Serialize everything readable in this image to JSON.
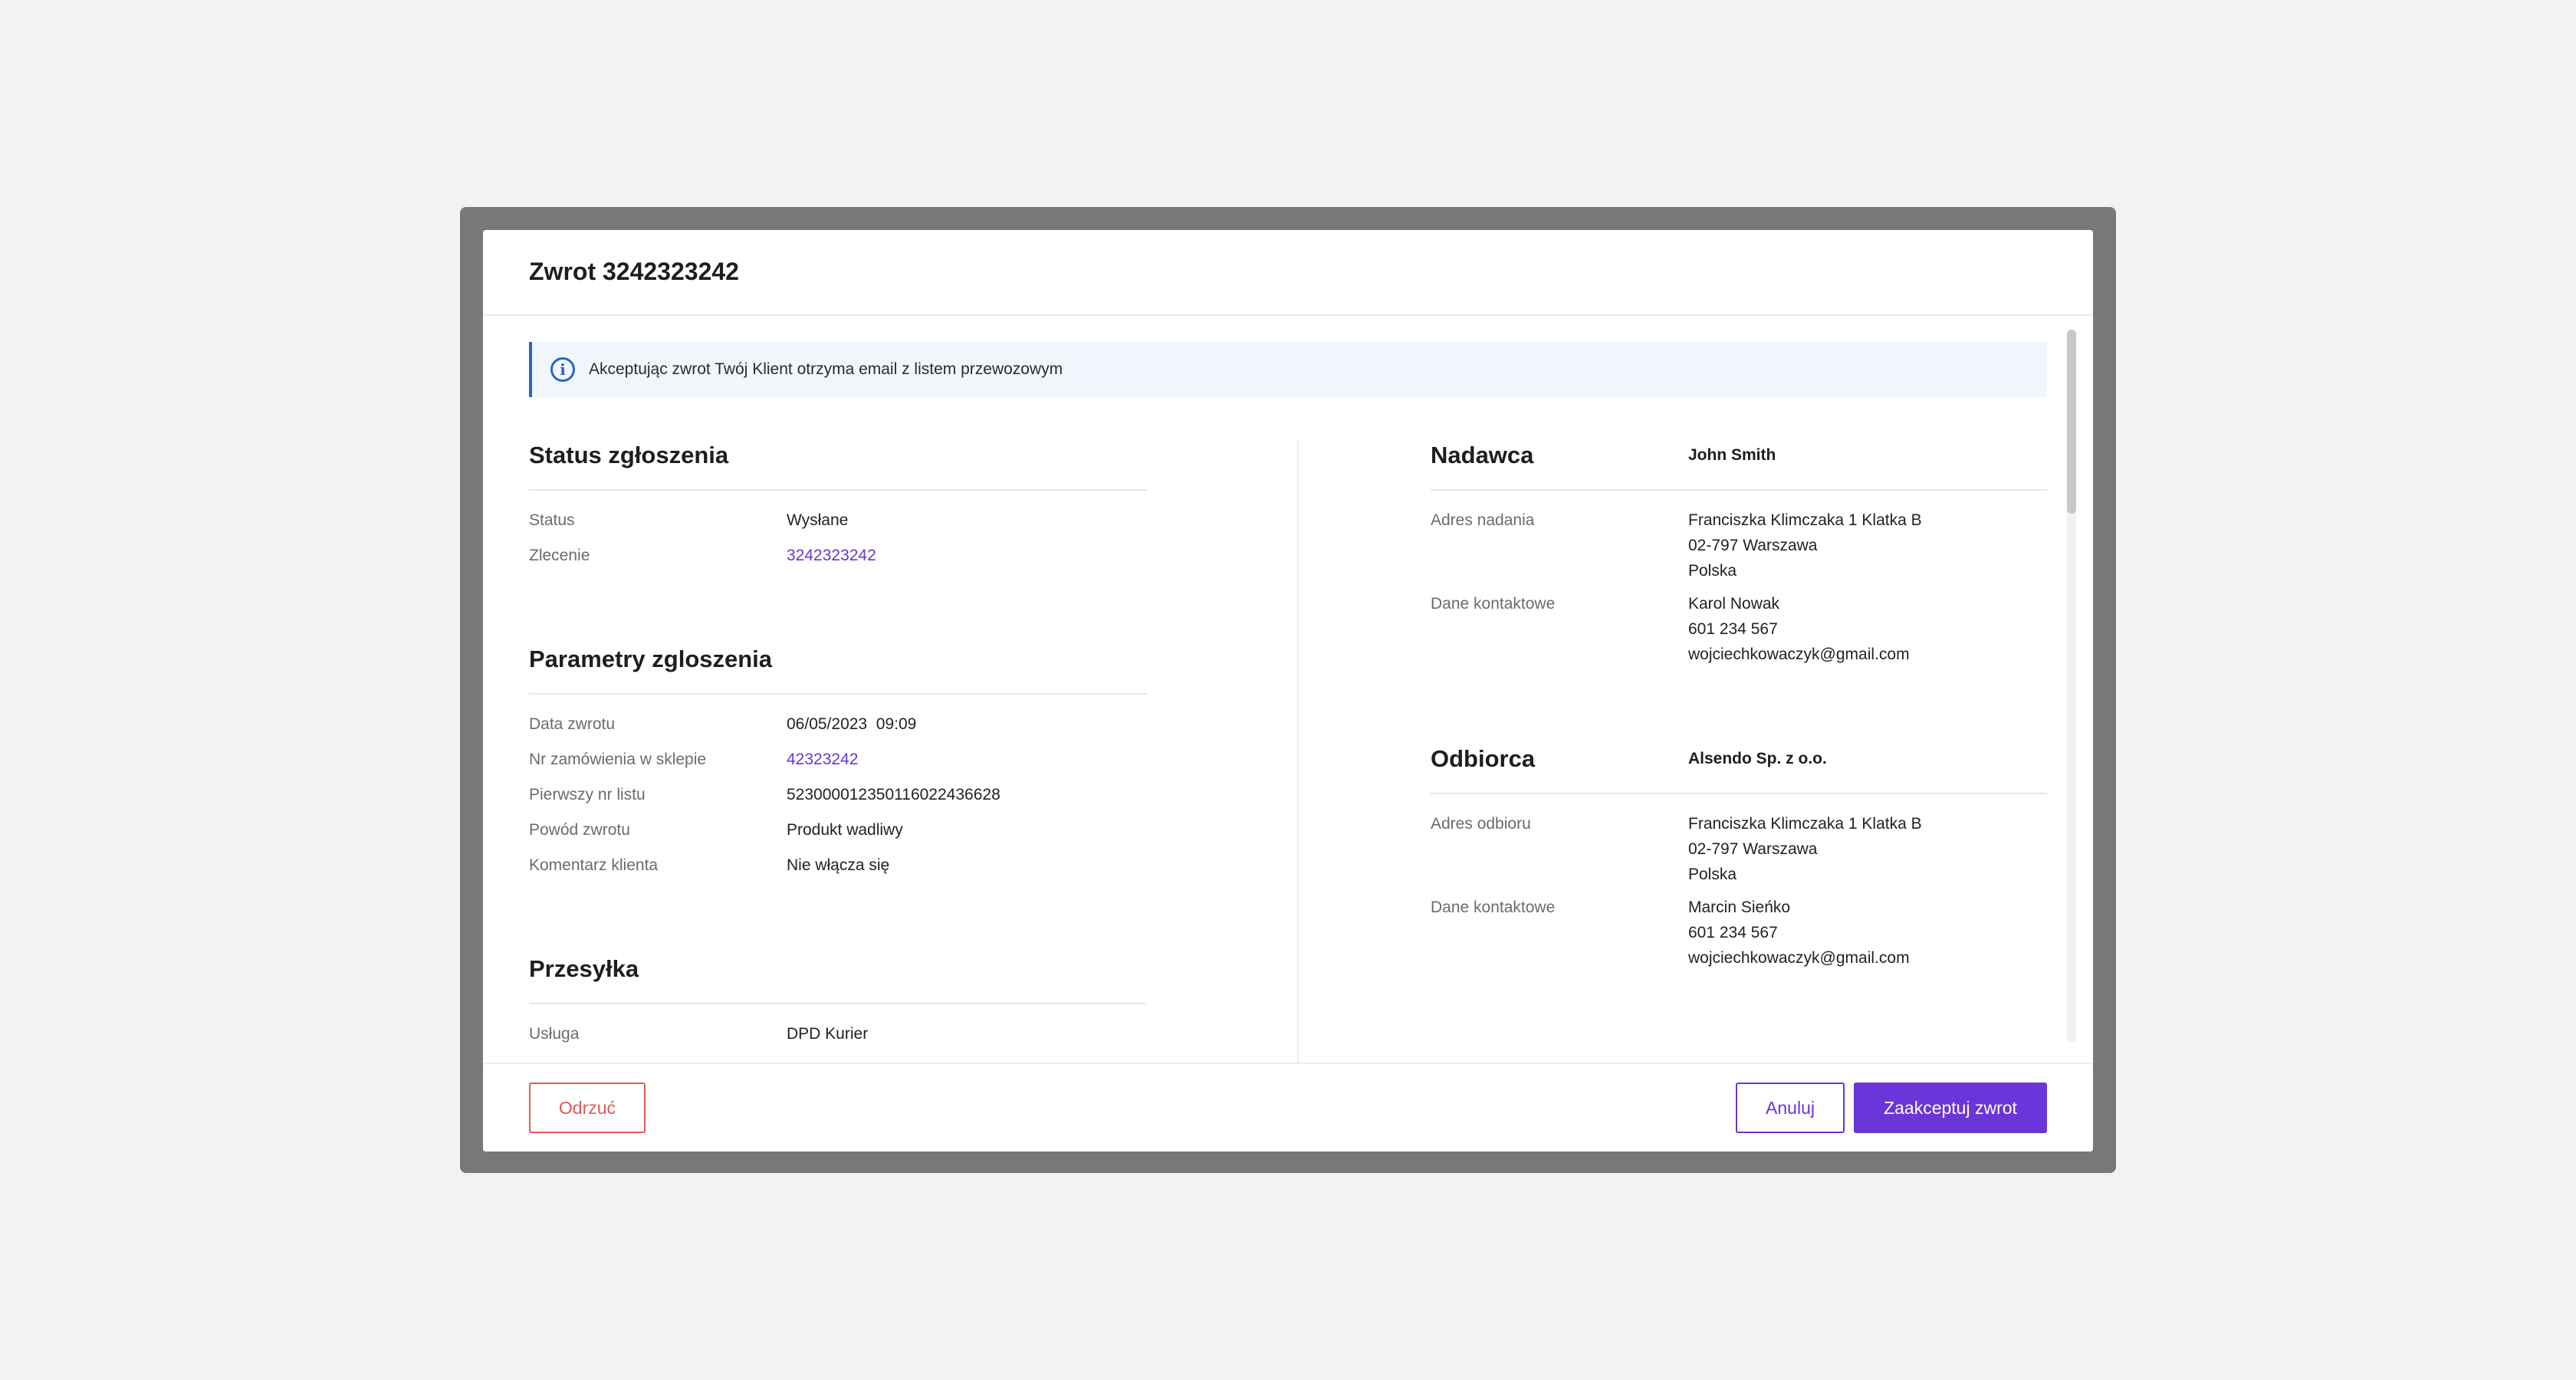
{
  "modal": {
    "title": "Zwrot 3242323242"
  },
  "info_banner": {
    "text": "Akceptując zwrot Twój Klient otrzyma email z listem przewozowym"
  },
  "status_section": {
    "title": "Status zgłoszenia",
    "rows": [
      {
        "label": "Status",
        "value": "Wysłane"
      },
      {
        "label": "Zlecenie",
        "value": "3242323242"
      }
    ]
  },
  "params_section": {
    "title": "Parametry zgloszenia",
    "rows": [
      {
        "label": "Data zwrotu",
        "value": "06/05/2023  09:09"
      },
      {
        "label": "Nr zamówienia w sklepie",
        "value": "42323242"
      },
      {
        "label": "Pierwszy nr listu",
        "value": "523000012350116022436628"
      },
      {
        "label": "Powód zwrotu",
        "value": "Produkt wadliwy"
      },
      {
        "label": "Komentarz klienta",
        "value": "Nie włącza się"
      }
    ]
  },
  "shipment_section": {
    "title": "Przesyłka",
    "rows": [
      {
        "label": "Usługa",
        "value": "DPD Kurier"
      }
    ]
  },
  "sender_section": {
    "title": "Nadawca",
    "name": "John Smith",
    "address_label": "Adres nadania",
    "address_lines": [
      "Franciszka Klimczaka 1 Klatka B",
      "02-797 Warszawa",
      "Polska"
    ],
    "contact_label": "Dane kontaktowe",
    "contact_lines": [
      "Karol Nowak",
      "601 234 567",
      "wojciechkowaczyk@gmail.com"
    ]
  },
  "recipient_section": {
    "title": "Odbiorca",
    "name": "Alsendo Sp. z o.o.",
    "address_label": "Adres odbioru",
    "address_lines": [
      "Franciszka Klimczaka 1 Klatka B",
      "02-797 Warszawa",
      "Polska"
    ],
    "contact_label": "Dane kontaktowe",
    "contact_lines": [
      "Marcin Sieńko",
      "601 234 567",
      "wojciechkowaczyk@gmail.com"
    ]
  },
  "footer": {
    "reject_label": "Odrzuć",
    "cancel_label": "Anuluj",
    "accept_label": "Zaakceptuj zwrot"
  },
  "colors": {
    "accent": "#6a35d9",
    "danger": "#e0594f",
    "info": "#2a66c4"
  }
}
